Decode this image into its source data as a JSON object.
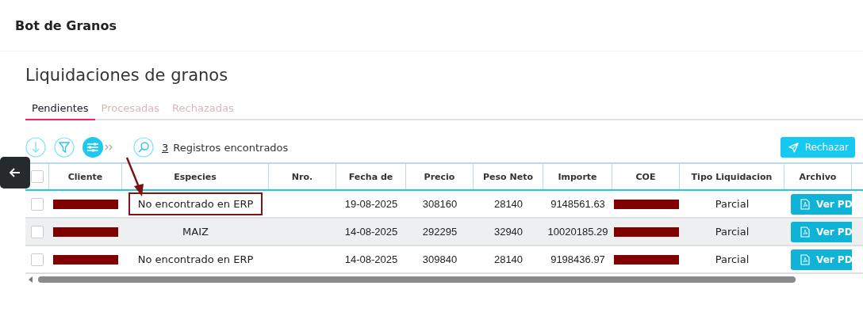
{
  "app_title": "Bot de Granos",
  "heading": "Liquidaciones de granos",
  "tabs": [
    {
      "label": "Pendientes",
      "selected": true
    },
    {
      "label": "Procesadas",
      "selected": false
    },
    {
      "label": "Rechazadas",
      "selected": false
    }
  ],
  "toolbar": {
    "count": "3",
    "count_label": "Registros encontrados",
    "reject_button": "Rechazar"
  },
  "table": {
    "select_all_checked": false,
    "columns": [
      "Cliente",
      "Especies",
      "Nro.",
      "Fecha de",
      "Precio",
      "Peso Neto",
      "Importe",
      "COE",
      "Tipo Liquidacion",
      "Archivo"
    ],
    "rows": [
      {
        "checked": false,
        "cliente_redacted": true,
        "especie": "No encontrado en ERP",
        "especie_marked": true,
        "nro": "",
        "fecha": "19-08-2025",
        "precio": "308160",
        "peso_neto": "28140",
        "importe": "9148561.63",
        "coe_redacted": true,
        "tipo": "Parcial",
        "archivo": "Ver PD",
        "shaded": false
      },
      {
        "checked": false,
        "cliente_redacted": true,
        "especie": "MAIZ",
        "especie_marked": false,
        "nro": "",
        "fecha": "14-08-2025",
        "precio": "292295",
        "peso_neto": "32940",
        "importe": "10020185.29",
        "coe_redacted": true,
        "tipo": "Parcial",
        "archivo": "Ver PD",
        "shaded": true
      },
      {
        "checked": false,
        "cliente_redacted": true,
        "especie": "No encontrado en ERP",
        "especie_marked": false,
        "nro": "",
        "fecha": "14-08-2025",
        "precio": "309840",
        "peso_neto": "28140",
        "importe": "9198436.97",
        "coe_redacted": true,
        "tipo": "Parcial",
        "archivo": "Ver PD",
        "shaded": false
      }
    ]
  }
}
